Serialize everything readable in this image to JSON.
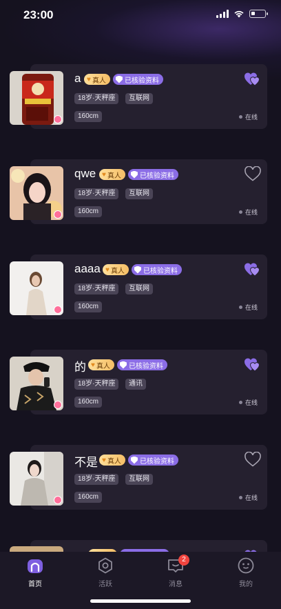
{
  "status": {
    "time": "23:00"
  },
  "cards": [
    {
      "name": "a",
      "real_badge": "真人",
      "verified_badge": "已核验资料",
      "age_sign": "18岁·天秤座",
      "industry": "互联网",
      "height": "160cm",
      "status": "在线",
      "liked": true
    },
    {
      "name": "qwe",
      "real_badge": "真人",
      "verified_badge": "已核验资料",
      "age_sign": "18岁·天秤座",
      "industry": "互联网",
      "height": "160cm",
      "status": "在线",
      "liked": false
    },
    {
      "name": "aaaa",
      "real_badge": "真人",
      "verified_badge": "已核验资料",
      "age_sign": "18岁·天秤座",
      "industry": "互联网",
      "height": "160cm",
      "status": "在线",
      "liked": true
    },
    {
      "name": "的",
      "real_badge": "真人",
      "verified_badge": "已核验资料",
      "age_sign": "18岁·天秤座",
      "industry": "通讯",
      "height": "160cm",
      "status": "在线",
      "liked": true
    },
    {
      "name": "不是",
      "real_badge": "真人",
      "verified_badge": "已核验资料",
      "age_sign": "18岁·天秤座",
      "industry": "互联网",
      "height": "160cm",
      "status": "在线",
      "liked": false
    }
  ],
  "tabbar": {
    "home": "首页",
    "active": "活跃",
    "messages": "消息",
    "messages_unread": "2",
    "mine": "我的"
  },
  "colors": {
    "accent": "#8b6de6",
    "background": "#15121f",
    "card": "#25202f",
    "badge_red": "#f0443f"
  }
}
